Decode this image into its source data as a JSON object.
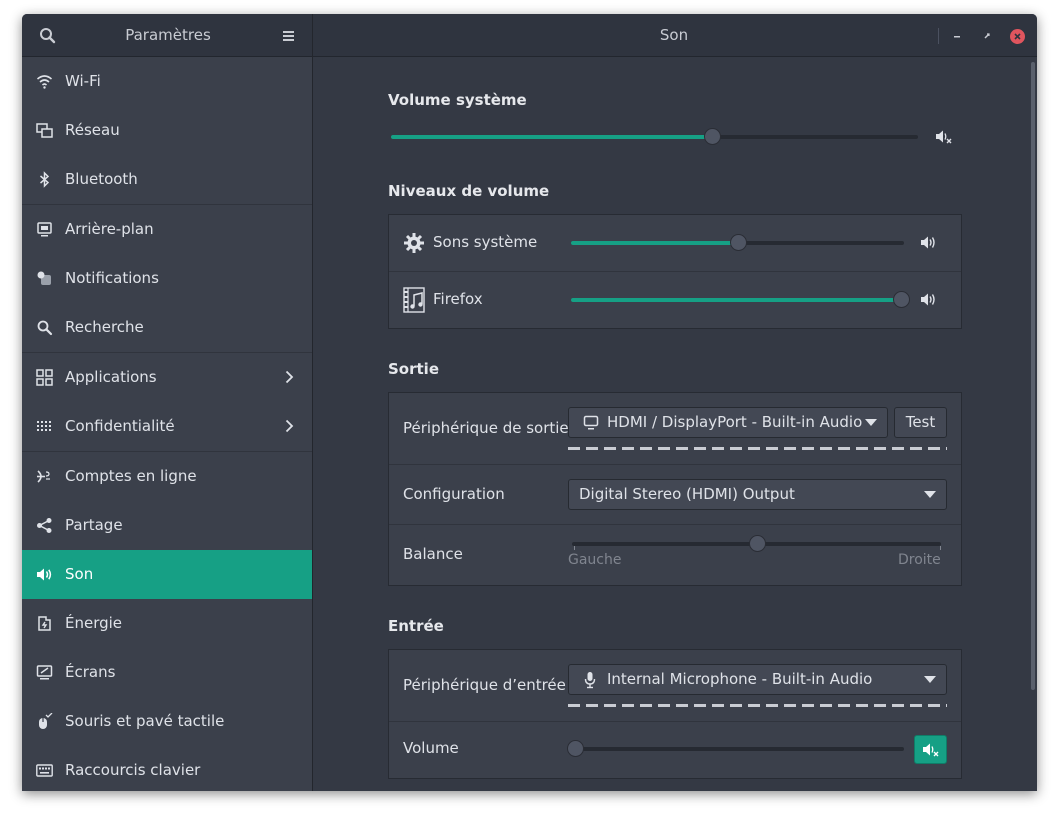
{
  "window": {
    "sidebar_title": "Paramètres",
    "panel_title": "Son"
  },
  "sidebar": {
    "items": [
      {
        "label": "Wi-Fi",
        "icon": "wifi-icon"
      },
      {
        "label": "Réseau",
        "icon": "network-icon"
      },
      {
        "label": "Bluetooth",
        "icon": "bluetooth-icon"
      },
      {
        "label": "Arrière-plan",
        "icon": "background-icon"
      },
      {
        "label": "Notifications",
        "icon": "notifications-icon"
      },
      {
        "label": "Recherche",
        "icon": "search-icon"
      },
      {
        "label": "Applications",
        "icon": "applications-icon",
        "has_submenu": true
      },
      {
        "label": "Confidentialité",
        "icon": "privacy-icon",
        "has_submenu": true
      },
      {
        "label": "Comptes en ligne",
        "icon": "online-accounts-icon"
      },
      {
        "label": "Partage",
        "icon": "share-icon"
      },
      {
        "label": "Son",
        "icon": "sound-icon",
        "active": true
      },
      {
        "label": "Énergie",
        "icon": "power-icon"
      },
      {
        "label": "Écrans",
        "icon": "displays-icon"
      },
      {
        "label": "Souris et pavé tactile",
        "icon": "mouse-icon"
      },
      {
        "label": "Raccourcis clavier",
        "icon": "keyboard-icon"
      }
    ]
  },
  "sound": {
    "system_volume": {
      "title": "Volume système",
      "level": 0.61,
      "muted_icon": "speaker-muted-icon"
    },
    "volume_levels": {
      "title": "Niveaux de volume",
      "rows": [
        {
          "label": "Sons système",
          "icon": "gear-icon",
          "level": 0.5
        },
        {
          "label": "Firefox",
          "icon": "film-music-icon",
          "level": 0.99
        }
      ]
    },
    "output": {
      "title": "Sortie",
      "device_label": "Périphérique de sortie",
      "device_value": "HDMI / DisplayPort - Built-in Audio",
      "test_label": "Test",
      "configuration_label": "Configuration",
      "configuration_value": "Digital Stereo (HDMI) Output",
      "balance_label": "Balance",
      "balance_left": "Gauche",
      "balance_right": "Droite",
      "balance_level": 0.5
    },
    "input": {
      "title": "Entrée",
      "device_label": "Périphérique d’entrée",
      "device_value": "Internal Microphone - Built-in Audio",
      "volume_label": "Volume",
      "volume_level": 0.0
    }
  },
  "colors": {
    "accent": "#16a085",
    "window_bg": "#343944",
    "sidebar_bg": "#3b404b",
    "close": "#e0555e"
  }
}
